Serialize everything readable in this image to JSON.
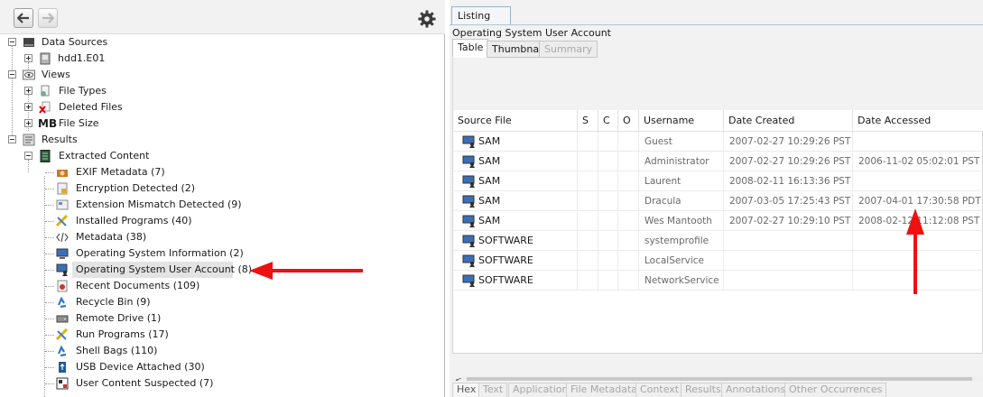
{
  "toolbar": {
    "back_icon": "left-arrow-icon",
    "forward_icon": "right-arrow-icon",
    "settings_icon": "gear-icon"
  },
  "tree": {
    "items": [
      {
        "label": "Data Sources"
      },
      {
        "label": "hdd1.E01"
      },
      {
        "label": "Views"
      },
      {
        "label": "File Types"
      },
      {
        "label": "Deleted Files"
      },
      {
        "label": "File Size",
        "prefix": "MB"
      },
      {
        "label": "Results"
      },
      {
        "label": "Extracted Content"
      },
      {
        "label": "EXIF Metadata (7)"
      },
      {
        "label": "Encryption Detected (2)"
      },
      {
        "label": "Extension Mismatch Detected (9)"
      },
      {
        "label": "Installed Programs (40)"
      },
      {
        "label": "Metadata (38)"
      },
      {
        "label": "Operating System Information (2)"
      },
      {
        "label": "Operating System User Account (8)"
      },
      {
        "label": "Recent Documents (109)"
      },
      {
        "label": "Recycle Bin (9)"
      },
      {
        "label": "Remote Drive (1)"
      },
      {
        "label": "Run Programs (17)"
      },
      {
        "label": "Shell Bags (110)"
      },
      {
        "label": "USB Device Attached (30)"
      },
      {
        "label": "User Content Suspected (7)"
      }
    ]
  },
  "listing": {
    "tab_label": "Listing",
    "title": "Operating System User Account",
    "view_tabs": [
      "Table",
      "Thumbnail",
      "Summary"
    ],
    "columns": [
      "Source File",
      "S",
      "C",
      "O",
      "Username",
      "Date Created",
      "Date Accessed"
    ],
    "rows": [
      {
        "source": "SAM",
        "username": "Guest",
        "created": "2007-02-27 10:29:26 PST",
        "accessed": ""
      },
      {
        "source": "SAM",
        "username": "Administrator",
        "created": "2007-02-27 10:29:26 PST",
        "accessed": "2006-11-02 05:02:01 PST"
      },
      {
        "source": "SAM",
        "username": "Laurent",
        "created": "2008-02-11 16:13:36 PST",
        "accessed": ""
      },
      {
        "source": "SAM",
        "username": "Dracula",
        "created": "2007-03-05 17:25:43 PST",
        "accessed": "2007-04-01 17:30:58 PDT"
      },
      {
        "source": "SAM",
        "username": "Wes Mantooth",
        "created": "2007-02-27 10:29:10 PST",
        "accessed": "2008-02-12 11:12:08 PST"
      },
      {
        "source": "SOFTWARE",
        "username": "systemprofile",
        "created": "",
        "accessed": ""
      },
      {
        "source": "SOFTWARE",
        "username": "LocalService",
        "created": "",
        "accessed": ""
      },
      {
        "source": "SOFTWARE",
        "username": "NetworkService",
        "created": "",
        "accessed": ""
      }
    ]
  },
  "bottom_tabs": [
    "Hex",
    "Text",
    "Application",
    "File Metadata",
    "Context",
    "Results",
    "Annotations",
    "Other Occurrences"
  ],
  "colors": {
    "arrow": "#ee1111",
    "selection": "#e3e3e3"
  }
}
